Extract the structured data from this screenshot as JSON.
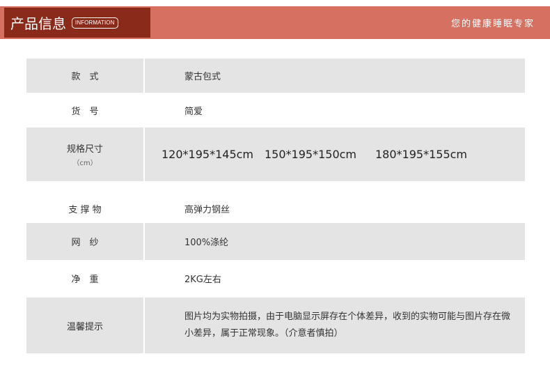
{
  "header": {
    "title": "产品信息",
    "badge": "INFORMATION",
    "slogan": "您的健康睡眠专家"
  },
  "rows": [
    {
      "label": "款　式",
      "value": "蒙古包式"
    },
    {
      "label": "货　号",
      "value": "简爱"
    },
    {
      "label": "规格尺寸",
      "sublabel": "（cm）",
      "sizes": [
        "120*195*145cm",
        "150*195*150cm",
        "180*195*155cm"
      ]
    },
    {
      "label": "支 撑 物",
      "value": "高弹力钢丝"
    },
    {
      "label": "网　纱",
      "value": "100%涤纶"
    },
    {
      "label": "净　重",
      "value": "2KG左右"
    },
    {
      "label": "温馨提示",
      "value": "图片均为实物拍摄，由于电脑显示屏存在个体差异，收到的实物可能与图片存在微小差异，属于正常现象。（介意者慎拍）"
    }
  ]
}
